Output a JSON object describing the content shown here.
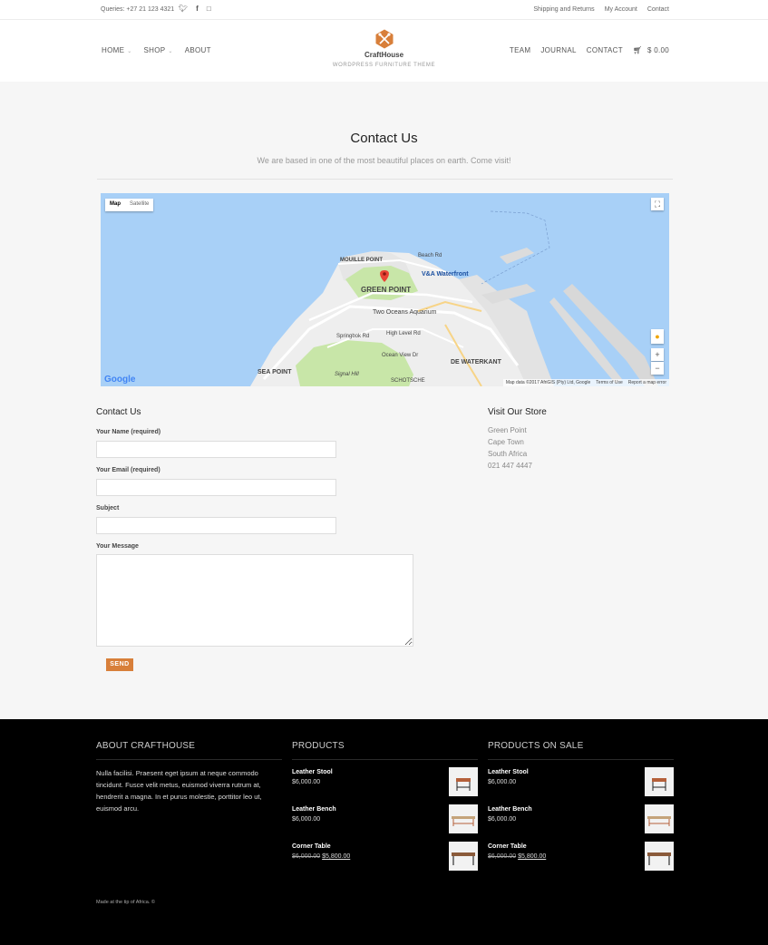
{
  "topbar": {
    "queries": "Queries: +27 21 123 4321",
    "social": [
      "twitter-icon",
      "facebook-icon",
      "instagram-icon"
    ],
    "links": [
      "Shipping and Returns",
      "My Account",
      "Contact"
    ]
  },
  "nav": {
    "left": [
      "HOME",
      "SHOP",
      "ABOUT"
    ],
    "right": [
      "TEAM",
      "JOURNAL",
      "CONTACT"
    ],
    "cart": "$ 0.00"
  },
  "logo": {
    "name": "CraftHouse",
    "tagline": "WORDPRESS FURNITURE THEME"
  },
  "page": {
    "title": "Contact Us",
    "subtitle": "We are based in one of the most beautiful places on earth. Come visit!"
  },
  "map": {
    "type_map": "Map",
    "type_satellite": "Satellite",
    "labels": {
      "mouille": "MOUILLE POINT",
      "beach": "Beach Rd",
      "green": "GREEN POINT",
      "va": "V&A Waterfront",
      "aquarium": "Two Oceans Aquarium",
      "high": "High Level Rd",
      "springbok": "Springbok Rd",
      "ocean": "Ocean View Dr",
      "sea": "SEA POINT",
      "signal": "Signal Hill",
      "dewaterkant": "DE WATERKANT",
      "schotsche": "SCHOTSCHE"
    },
    "attribution": [
      "Map data ©2017 AfriGIS (Pty) Ltd, Google",
      "Terms of Use",
      "Report a map error"
    ],
    "google": "Google"
  },
  "form": {
    "heading": "Contact Us",
    "name_label": "Your Name (required)",
    "email_label": "Your Email (required)",
    "subject_label": "Subject",
    "message_label": "Your Message",
    "send": "SEND"
  },
  "store": {
    "heading": "Visit Our Store",
    "lines": [
      "Green Point",
      "Cape Town",
      "South Africa",
      "021 447 4447"
    ]
  },
  "footer": {
    "about_heading": "ABOUT CRAFTHOUSE",
    "about_text": "Nulla facilisi. Praesent eget ipsum at neque commodo tincidunt. Fusce velit metus, euismod viverra rutrum at, hendrerit a magna. In et purus molestie, porttitor leo ut, euismod arcu.",
    "products_heading": "PRODUCTS",
    "products": [
      {
        "name": "Leather Stool",
        "price": "$6,000.00"
      },
      {
        "name": "Leather Bench",
        "price": "$6,000.00"
      },
      {
        "name": "Corner Table",
        "old_price": "$6,000.00",
        "price": "$5,800.00"
      }
    ],
    "sale_heading": "PRODUCTS ON SALE",
    "sale": [
      {
        "name": "Leather Stool",
        "price": "$6,000.00"
      },
      {
        "name": "Leather Bench",
        "price": "$6,000.00"
      },
      {
        "name": "Corner Table",
        "old_price": "$6,000.00",
        "price": "$5,800.00"
      }
    ],
    "made": "Made at the tip of Africa. ©"
  },
  "colors": {
    "accent": "#d87f3a",
    "footer_bg": "#000000",
    "water": "#a8d0f7",
    "marker": "#e94335"
  }
}
